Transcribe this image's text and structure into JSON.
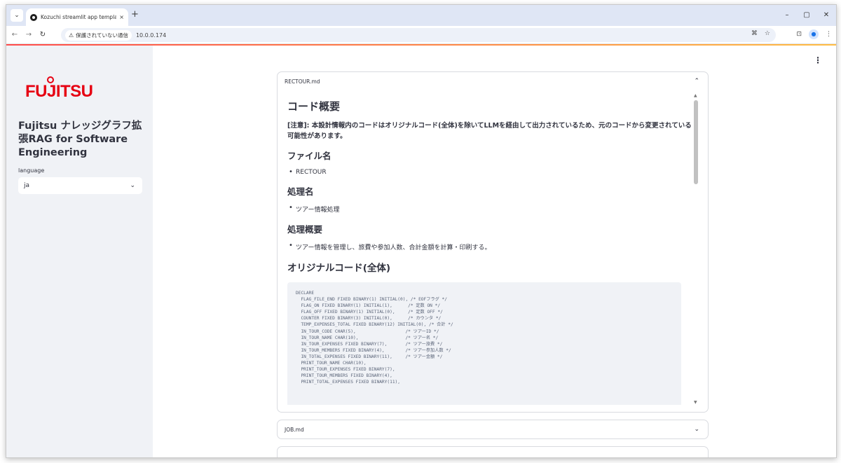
{
  "browser": {
    "tab_title": "Kozuchi streamlit app template",
    "tab_close": "×",
    "new_tab": "+",
    "security_label": "保護されていない通信",
    "url": "10.0.0.174",
    "window_controls": [
      "–",
      "▢",
      "✕"
    ]
  },
  "sidebar": {
    "logo_text": "FUJITSU",
    "app_title": "Fujitsu ナレッジグラフ拡張RAG for Software Engineering",
    "language_label": "language",
    "language_value": "ja"
  },
  "main": {
    "menu_icon": "⋮",
    "expander1": {
      "title": "RECTOUR.md",
      "heading": "コード概要",
      "note": "[注意]: 本設計情報内のコードはオリジナルコード(全体)を除いてLLMを経由して出力されているため、元のコードから変更されている可能性があります。",
      "file_heading": "ファイル名",
      "file_item": "RECTOUR",
      "proc_heading": "処理名",
      "proc_item": "ツアー情報処理",
      "summary_heading": "処理概要",
      "summary_item": "ツアー情報を管理し、旅費や参加人数、合計金額を計算・印刷する。",
      "code_heading": "オリジナルコード(全体)",
      "code_lines": [
        "DECLARE",
        "  FLAG_FILE_END FIXED BINARY(1) INITIAL(0), /* EOFフラグ */",
        "  FLAG_ON FIXED BINARY(1) INITIAL(1),      /* 定数 ON */",
        "  FLAG_OFF FIXED BINARY(1) INITIAL(0),     /* 定数 OFF */",
        "  COUNTER FIXED BINARY(3) INITIAL(0),      /* カウンタ */",
        "  TEMP_EXPENSES_TOTAL FIXED BINARY(12) INITIAL(0), /* 合計 */",
        "  IN_TOUR_CODE CHAR(5),                   /* ツアーID */",
        "  IN_TOUR_NAME CHAR(10),                  /* ツアー名 */",
        "  IN_TOUR_EXPENSES FIXED BINARY(7),       /* ツアー旅費 */",
        "  IN_TOUR_MEMBERS FIXED BINARY(4),        /* ツアー参加人数 */",
        "  IN_TOTAL_EXPENSES FIXED BINARY(11),     /* ツアー金額 */",
        "  PRINT_TOUR_NAME CHAR(10),",
        "  PRINT_TOUR_EXPENSES FIXED BINARY(7),",
        "  PRINT_TOUR_MEMBERS FIXED BINARY(4),",
        "  PRINT_TOTAL_EXPENSES FIXED BINARY(11),"
      ]
    },
    "expander2": {
      "title": "JOB.md"
    }
  }
}
